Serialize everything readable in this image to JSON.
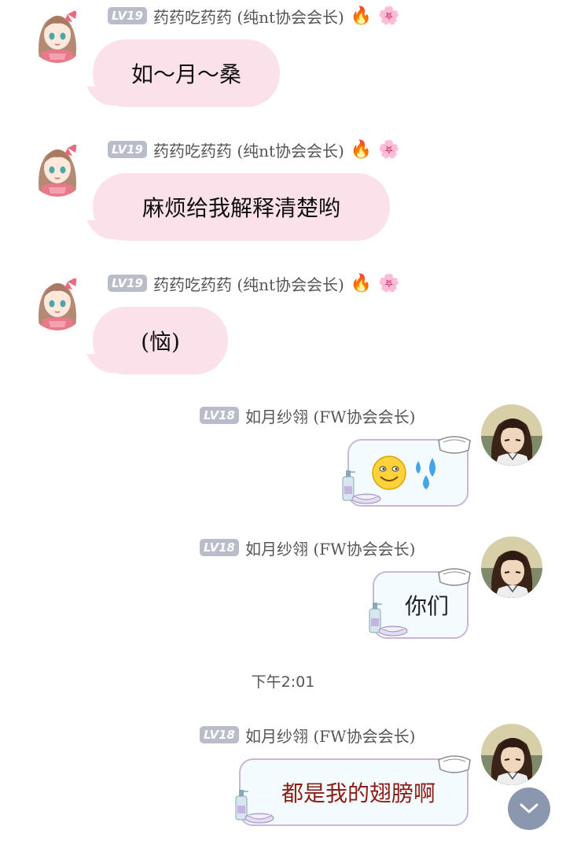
{
  "messages": [
    {
      "side": "left",
      "level": "LV19",
      "nickname": "药药吃药药 (纯nt协会会长)",
      "badges": [
        "fire-icon",
        "flower-face-icon"
      ],
      "text": "如～月～桑"
    },
    {
      "side": "left",
      "level": "LV19",
      "nickname": "药药吃药药 (纯nt协会会长)",
      "badges": [
        "fire-icon",
        "flower-face-icon"
      ],
      "text": "麻烦给我解释清楚哟"
    },
    {
      "side": "left",
      "level": "LV19",
      "nickname": "药药吃药药 (纯nt协会会长)",
      "badges": [
        "fire-icon",
        "flower-face-icon"
      ],
      "text": "(恼)"
    },
    {
      "side": "right",
      "level": "LV18",
      "nickname": "如月纱翎 (FW协会会长)",
      "text": "",
      "emoji": [
        "sweat-grin-emoji",
        "sweat-drops-emoji"
      ]
    },
    {
      "side": "right",
      "level": "LV18",
      "nickname": "如月纱翎 (FW协会会长)",
      "text": "你们"
    },
    {
      "side": "right",
      "level": "LV18",
      "nickname": "如月纱翎 (FW协会会长)",
      "text": "都是我的翅膀啊"
    }
  ],
  "timestamp": "下午2:01",
  "colors": {
    "pink_bubble": "#fbe2ea",
    "level_badge": "#b9bcc9",
    "right_bubble_border": "#c8b7d6",
    "scroll_button": "#8b97ae"
  }
}
